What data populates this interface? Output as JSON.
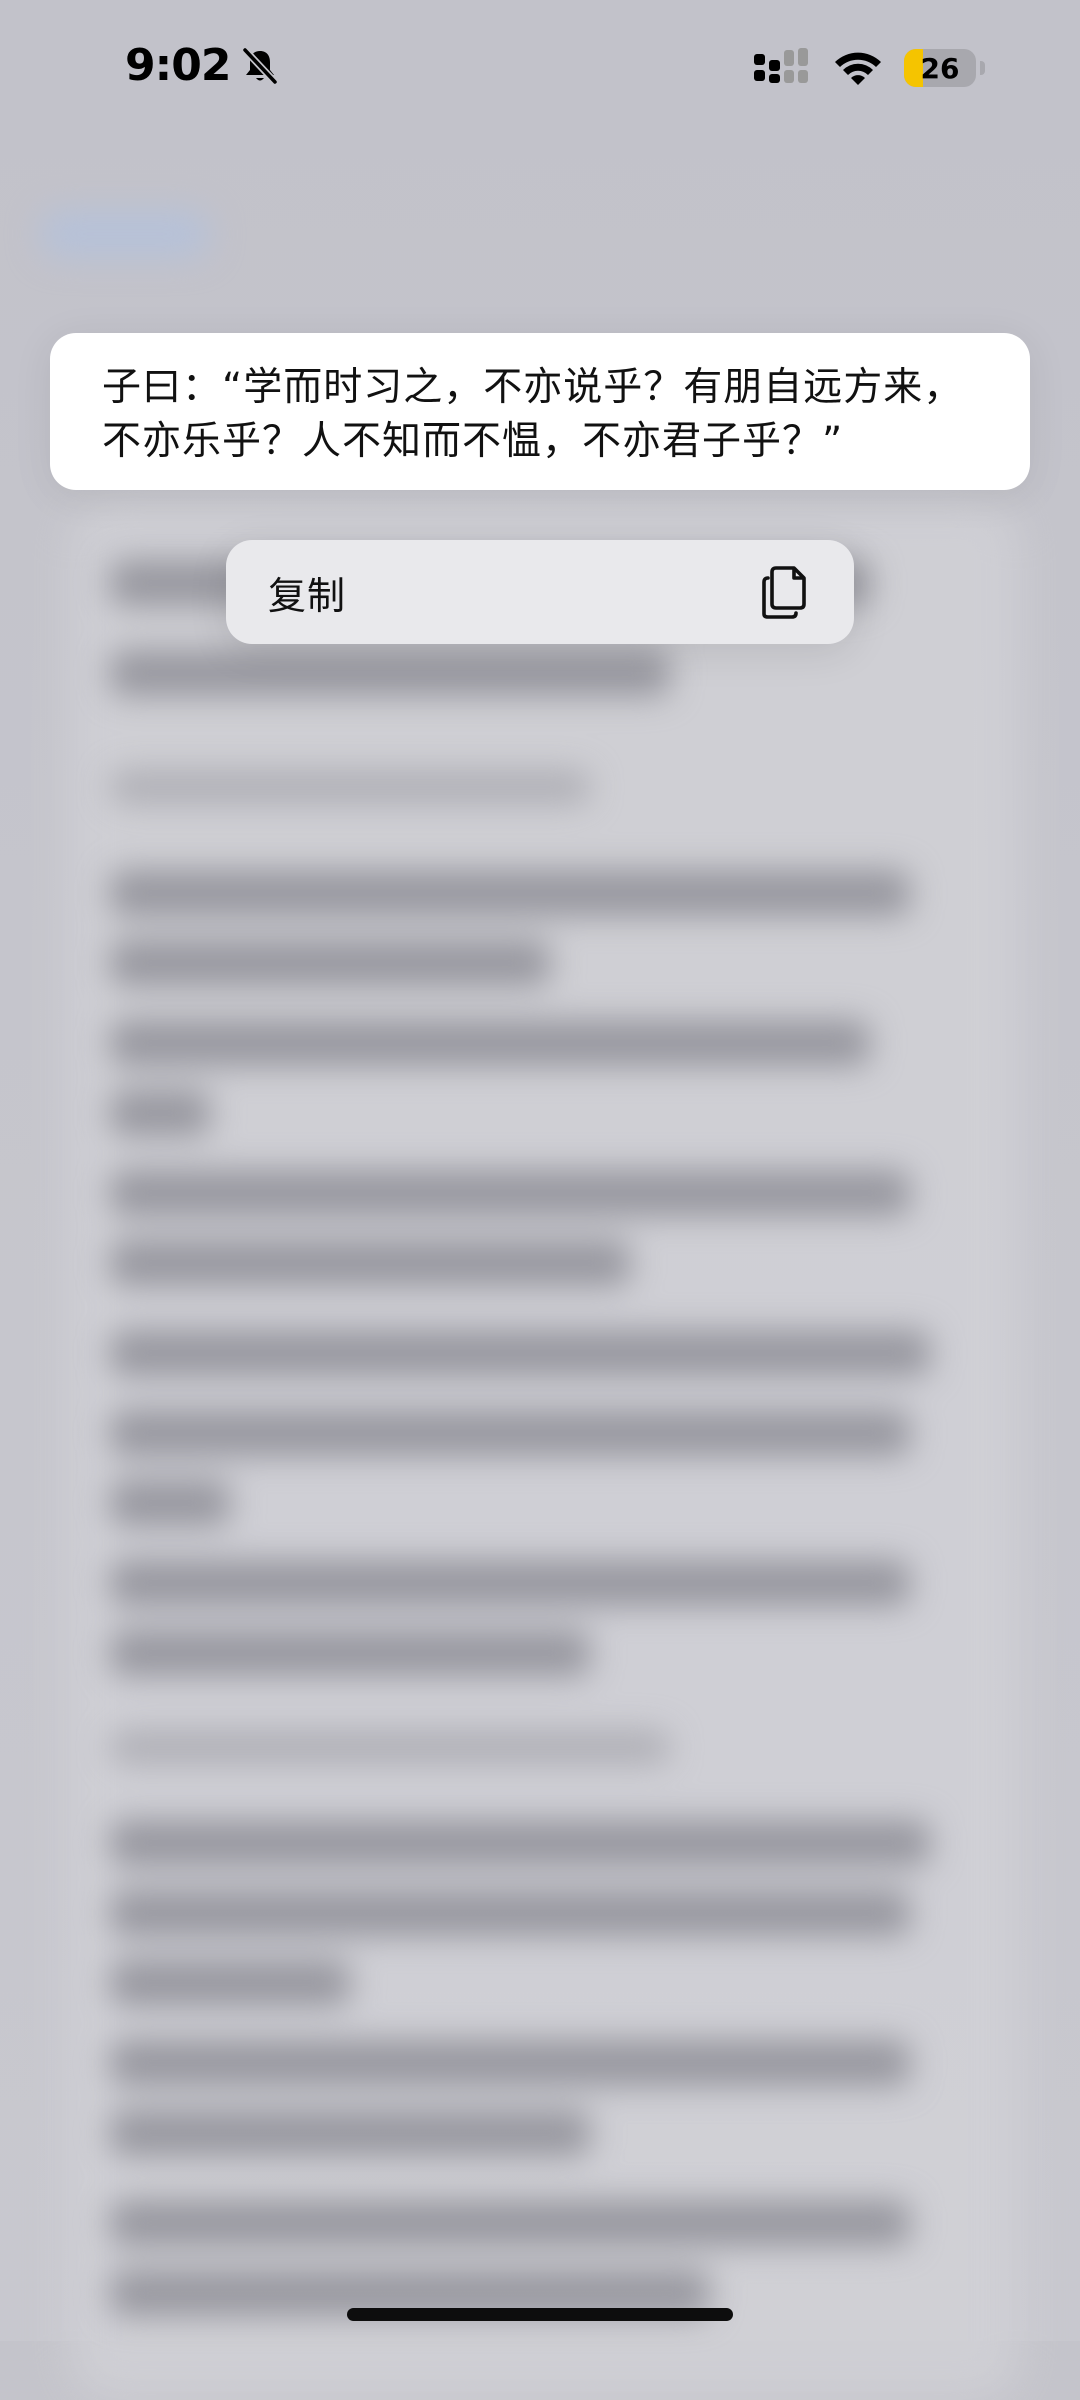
{
  "status_bar": {
    "time": "9:02",
    "silent_icon": "bell-slash-icon",
    "signal_icon": "cellular-signal-icon",
    "wifi_icon": "wifi-icon",
    "battery_level": "26",
    "battery_fill_percent": 26,
    "battery_color": "#f5c400"
  },
  "selection": {
    "text_line_1": "子曰：“学而时习之，不亦说乎？有朋自远方来，",
    "text_line_2": "不亦乐乎？人不知而不愠，不亦君子乎？”"
  },
  "context_menu": {
    "items": [
      {
        "label": "复制",
        "icon": "copy-icon"
      }
    ]
  }
}
